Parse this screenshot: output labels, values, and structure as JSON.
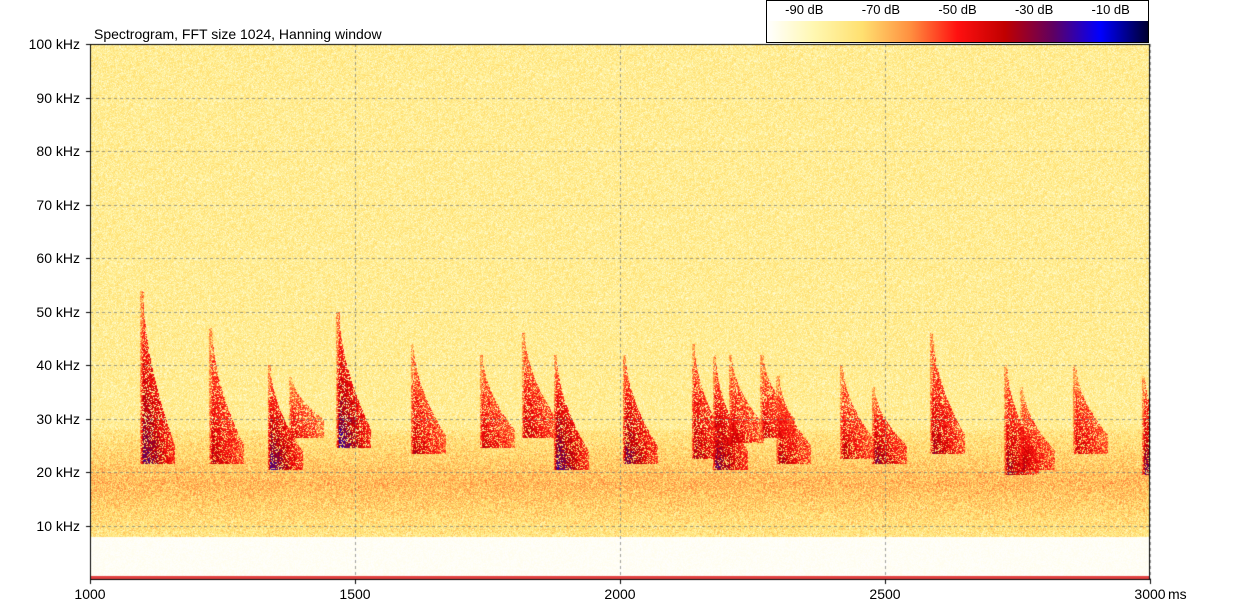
{
  "chart_data": {
    "type": "heatmap",
    "title": "Spectrogram, FFT size 1024, Hanning window",
    "x_axis": {
      "range": [
        1000,
        3000
      ],
      "unit": "ms",
      "ticks": [
        {
          "value": 1000,
          "label": "1000"
        },
        {
          "value": 1500,
          "label": "1500"
        },
        {
          "value": 2000,
          "label": "2000"
        },
        {
          "value": 2500,
          "label": "2500"
        },
        {
          "value": 3000,
          "label": "3000"
        }
      ]
    },
    "y_axis": {
      "range": [
        0,
        100
      ],
      "unit": "kHz",
      "ticks": [
        {
          "value": 10,
          "label": "10 kHz"
        },
        {
          "value": 20,
          "label": "20 kHz"
        },
        {
          "value": 30,
          "label": "30 kHz"
        },
        {
          "value": 40,
          "label": "40 kHz"
        },
        {
          "value": 50,
          "label": "50 kHz"
        },
        {
          "value": 60,
          "label": "60 kHz"
        },
        {
          "value": 70,
          "label": "70 kHz"
        },
        {
          "value": 80,
          "label": "80 kHz"
        },
        {
          "value": 90,
          "label": "90 kHz"
        },
        {
          "value": 100,
          "label": "100 kHz"
        }
      ]
    },
    "grid": true,
    "colorbar": {
      "placement": "top-right",
      "labels": [
        {
          "value": -90,
          "label": "-90 dB"
        },
        {
          "value": -70,
          "label": "-70 dB"
        },
        {
          "value": -50,
          "label": "-50 dB"
        },
        {
          "value": -30,
          "label": "-30 dB"
        },
        {
          "value": -10,
          "label": "-10 dB"
        }
      ],
      "colors": [
        "#ffffff",
        "#fff7b0",
        "#ffe070",
        "#ff9040",
        "#ff1010",
        "#c00000",
        "#600060",
        "#0000ff",
        "#000030"
      ]
    },
    "background_noise_band": {
      "low_khz": 8,
      "high_khz": 28
    },
    "calls": [
      {
        "t_ms": 1100,
        "f_start_khz": 52,
        "f_end_khz": 23,
        "peak_db": -25
      },
      {
        "t_ms": 1230,
        "f_start_khz": 45,
        "f_end_khz": 23,
        "peak_db": -38
      },
      {
        "t_ms": 1340,
        "f_start_khz": 38,
        "f_end_khz": 22,
        "peak_db": -24
      },
      {
        "t_ms": 1380,
        "f_start_khz": 36,
        "f_end_khz": 28,
        "peak_db": -45
      },
      {
        "t_ms": 1470,
        "f_start_khz": 48,
        "f_end_khz": 26,
        "peak_db": -22
      },
      {
        "t_ms": 1610,
        "f_start_khz": 42,
        "f_end_khz": 25,
        "peak_db": -40
      },
      {
        "t_ms": 1740,
        "f_start_khz": 40,
        "f_end_khz": 26,
        "peak_db": -42
      },
      {
        "t_ms": 1820,
        "f_start_khz": 44,
        "f_end_khz": 28,
        "peak_db": -40
      },
      {
        "t_ms": 1880,
        "f_start_khz": 40,
        "f_end_khz": 22,
        "peak_db": -24
      },
      {
        "t_ms": 2010,
        "f_start_khz": 40,
        "f_end_khz": 23,
        "peak_db": -28
      },
      {
        "t_ms": 2140,
        "f_start_khz": 42,
        "f_end_khz": 24,
        "peak_db": -36
      },
      {
        "t_ms": 2180,
        "f_start_khz": 40,
        "f_end_khz": 22,
        "peak_db": -28
      },
      {
        "t_ms": 2210,
        "f_start_khz": 40,
        "f_end_khz": 27,
        "peak_db": -42
      },
      {
        "t_ms": 2270,
        "f_start_khz": 40,
        "f_end_khz": 28,
        "peak_db": -42
      },
      {
        "t_ms": 2300,
        "f_start_khz": 36,
        "f_end_khz": 23,
        "peak_db": -38
      },
      {
        "t_ms": 2420,
        "f_start_khz": 38,
        "f_end_khz": 24,
        "peak_db": -40
      },
      {
        "t_ms": 2480,
        "f_start_khz": 34,
        "f_end_khz": 23,
        "peak_db": -32
      },
      {
        "t_ms": 2590,
        "f_start_khz": 44,
        "f_end_khz": 25,
        "peak_db": -36
      },
      {
        "t_ms": 2730,
        "f_start_khz": 38,
        "f_end_khz": 21,
        "peak_db": -34
      },
      {
        "t_ms": 2760,
        "f_start_khz": 34,
        "f_end_khz": 22,
        "peak_db": -40
      },
      {
        "t_ms": 2860,
        "f_start_khz": 38,
        "f_end_khz": 25,
        "peak_db": -42
      },
      {
        "t_ms": 2990,
        "f_start_khz": 36,
        "f_end_khz": 21,
        "peak_db": -28
      }
    ]
  }
}
